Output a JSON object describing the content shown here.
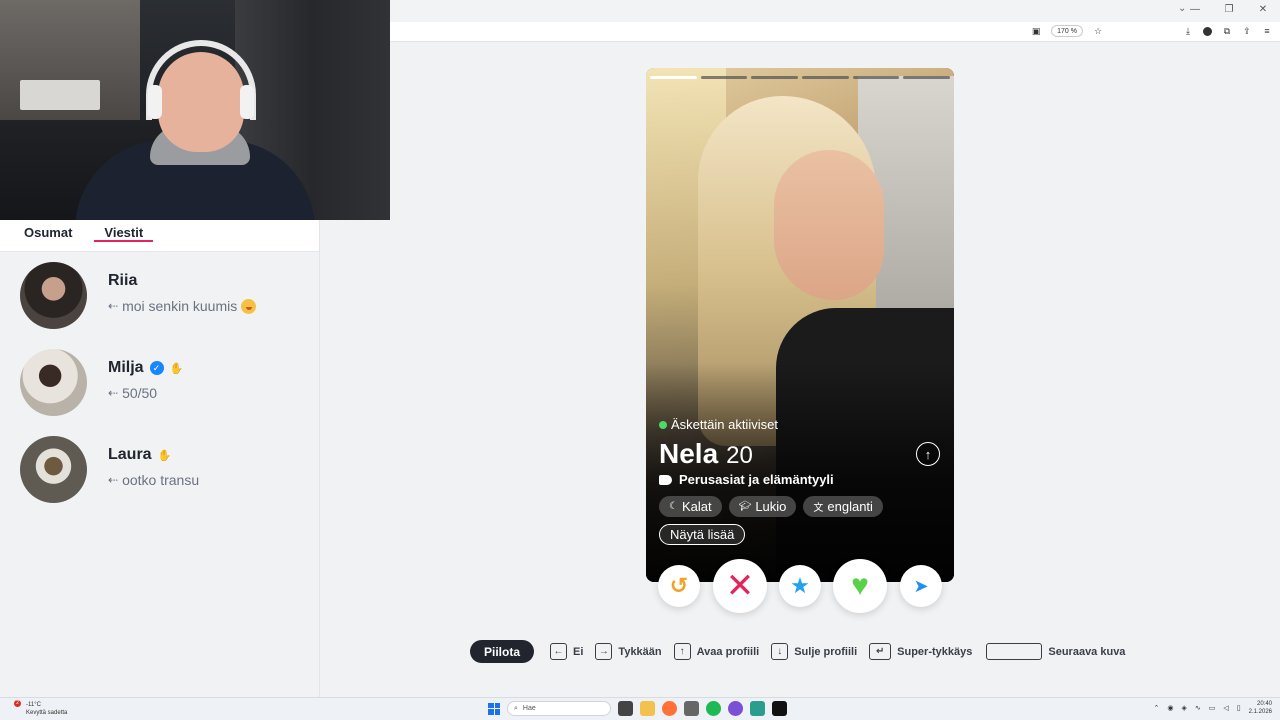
{
  "browser": {
    "zoom": "170 %",
    "tab_chevron": "⌄",
    "window_controls": [
      "—",
      "❐",
      "✕"
    ]
  },
  "sidebar": {
    "tabs": [
      {
        "label": "Osumat",
        "active": false
      },
      {
        "label": "Viestit",
        "active": true
      }
    ],
    "messages": [
      {
        "name": "Riia",
        "preview": "moi senkin kuumis",
        "verified": false,
        "wave": false,
        "emoji": "blush-face"
      },
      {
        "name": "Milja",
        "preview": "50/50",
        "verified": true,
        "wave": true
      },
      {
        "name": "Laura",
        "preview": "ootko transu",
        "verified": false,
        "wave": true
      }
    ]
  },
  "profile": {
    "activity": "Äskettäin aktiiviset",
    "name": "Nela",
    "age": "20",
    "section": "Perusasiat ja elämäntyyli",
    "chips": [
      {
        "label": "Kalat",
        "icon": "moon-icon"
      },
      {
        "label": "Lukio",
        "icon": "graduation-cap-icon"
      },
      {
        "label": "englanti",
        "icon": "translate-icon"
      }
    ],
    "more_button": "Näytä lisää",
    "photo_count": 6,
    "photo_index": 1
  },
  "actions": {
    "rewind_icon": "↺",
    "nope_icon": "✕",
    "star_icon": "★",
    "heart_icon": "♥",
    "boost_icon": "➤"
  },
  "shortcuts": {
    "hide_label": "Piilota",
    "items": [
      {
        "key": "←",
        "label": "Ei"
      },
      {
        "key": "→",
        "label": "Tykkään"
      },
      {
        "key": "↑",
        "label": "Avaa profiili"
      },
      {
        "key": "↓",
        "label": "Sulje profiili"
      },
      {
        "key": "↵",
        "label": "Super-tykkäys"
      },
      {
        "key": "",
        "label": "Seuraava kuva"
      }
    ]
  },
  "taskbar": {
    "weather_temp": "-11°C",
    "weather_desc": "Kevyttä sadetta",
    "notification_count": "2",
    "search_placeholder": "Hae",
    "time": "20:40",
    "date": "2.1.2026"
  },
  "colors": {
    "accent": "#e2255d",
    "nope": "#e2255d",
    "rewind": "#f3a225",
    "superlike": "#1fa2f2",
    "like": "#5bd14a",
    "boost": "#1e90f0"
  }
}
